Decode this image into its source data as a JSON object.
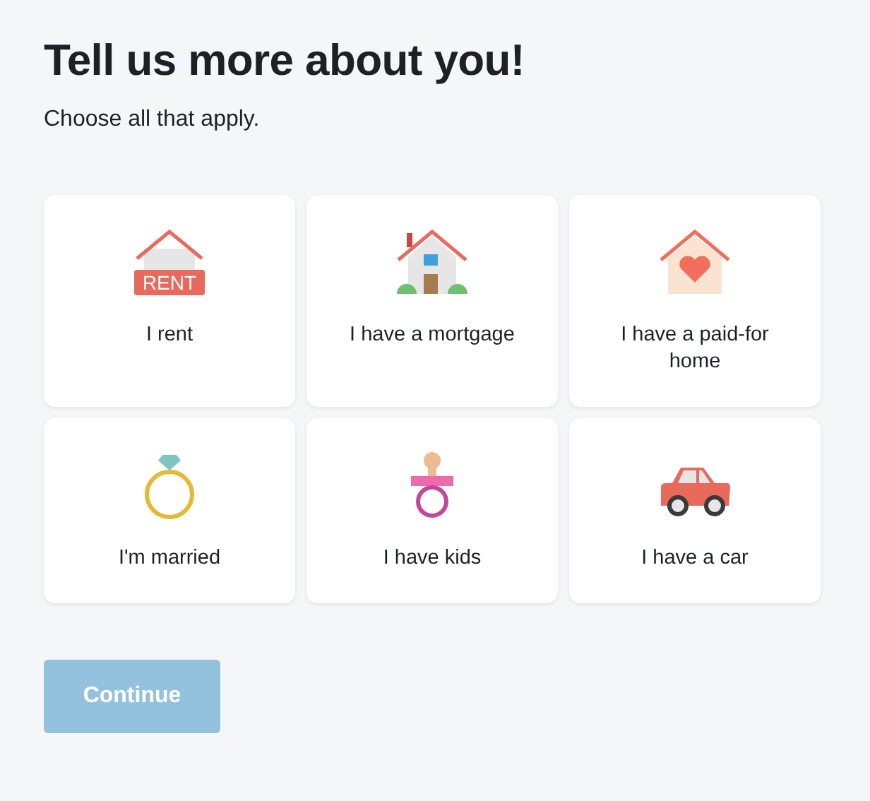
{
  "title": "Tell us more about you!",
  "subtitle": "Choose all that apply.",
  "options": [
    {
      "kind": "rent",
      "label": "I rent",
      "icon_text": "RENT"
    },
    {
      "kind": "mortgage",
      "label": "I have a mortgage"
    },
    {
      "kind": "paid",
      "label": "I have a paid-for home"
    },
    {
      "kind": "married",
      "label": "I'm married"
    },
    {
      "kind": "kids",
      "label": "I have kids"
    },
    {
      "kind": "car",
      "label": "I have a car"
    }
  ],
  "continue_button": {
    "label": "Continue",
    "disabled": true
  }
}
